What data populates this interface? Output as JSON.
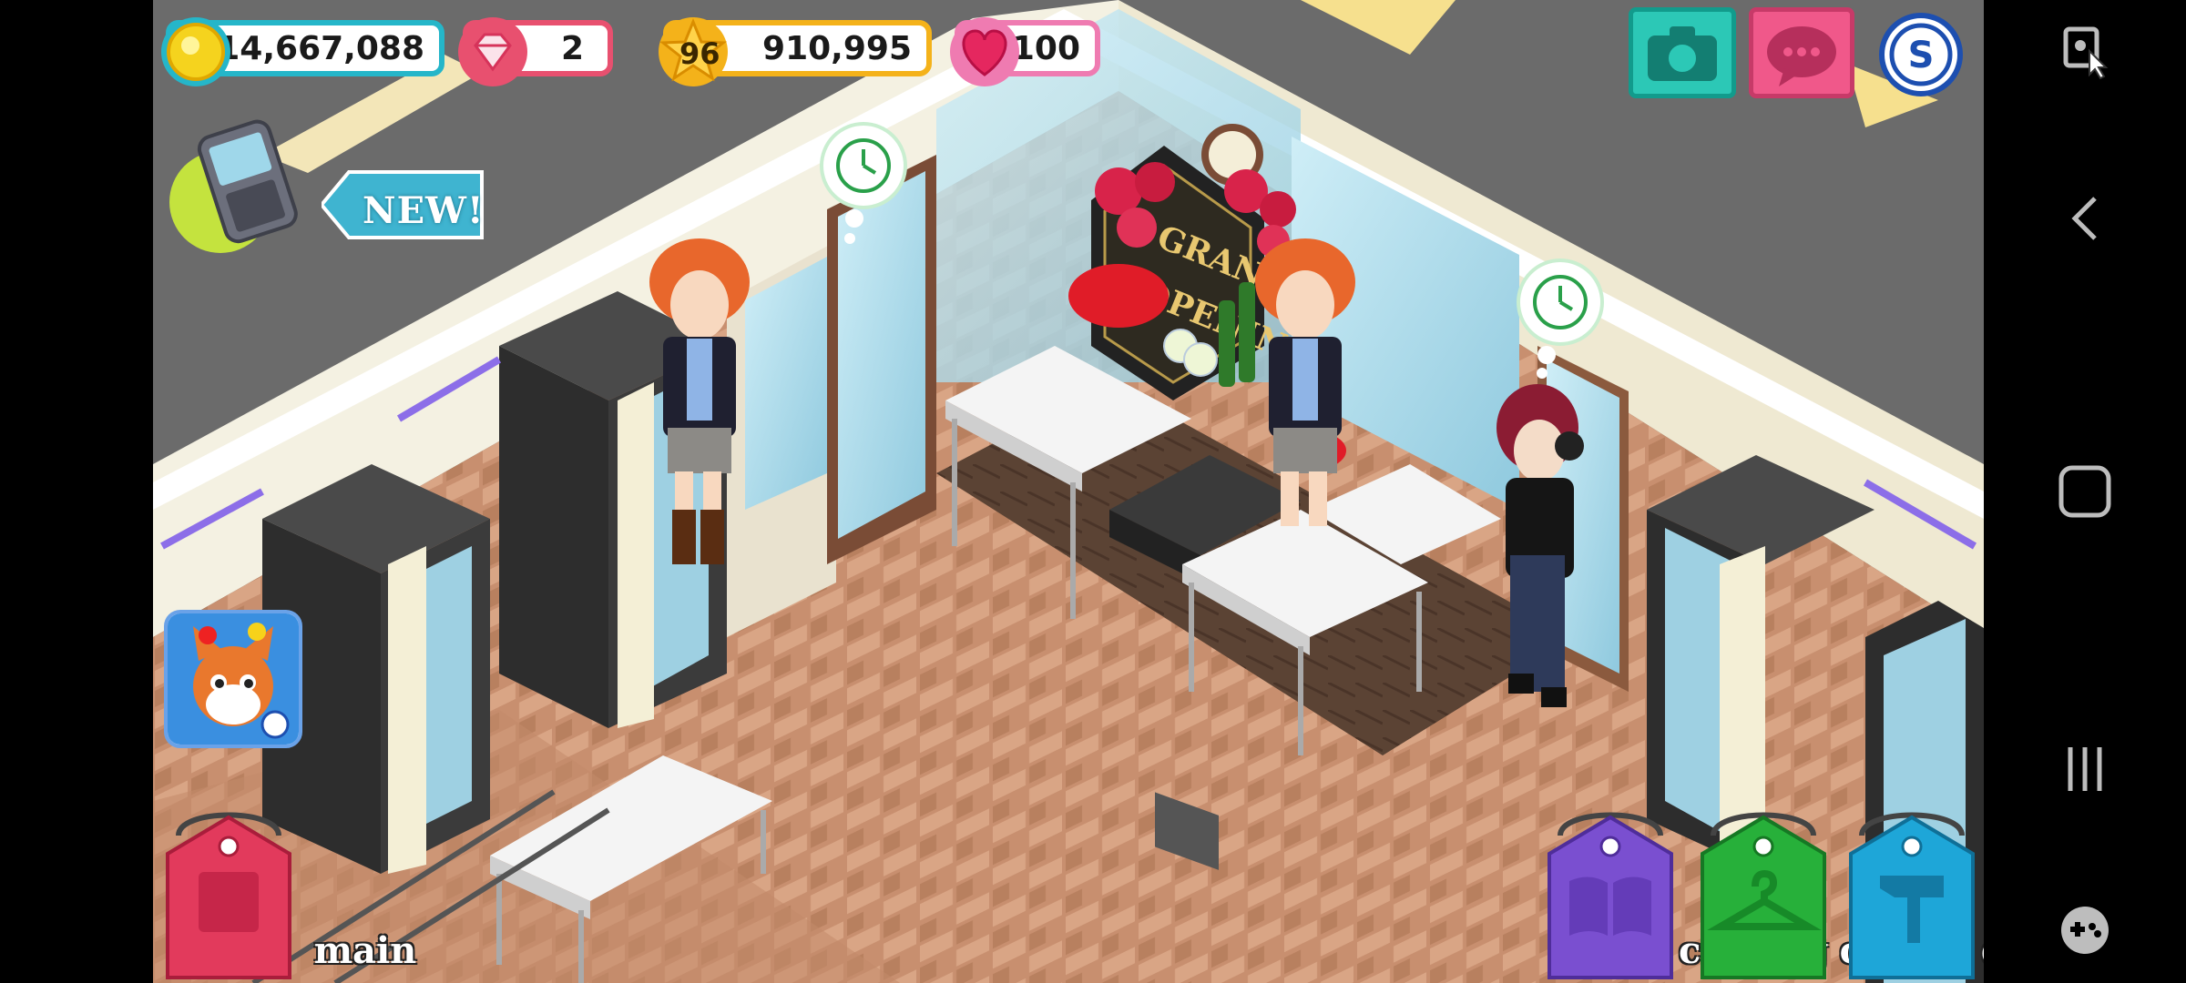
{
  "hud": {
    "coins": "14,667,088",
    "gems": "2",
    "level": "96",
    "experience": "910,995",
    "hearts": "100"
  },
  "badges": {
    "new_label": "NEW!"
  },
  "scene": {
    "sign_line1": "GRAND",
    "sign_line2": "OPENING"
  },
  "bottom_tabs": {
    "main": "main",
    "catalog": "catalog",
    "closet": "closet",
    "design": "design"
  },
  "colors": {
    "coin_border": "#25b6c9",
    "gem_border": "#e8506f",
    "xp_border": "#f4b21a",
    "heart_border": "#ef7bb1",
    "main_tab": "#e23a5c",
    "catalog_tab": "#7a4fd0",
    "closet_tab": "#27b03a",
    "design_tab": "#1ea6d8"
  },
  "icons": {
    "coin": "coin-icon",
    "gem": "gem-icon",
    "star": "star-icon",
    "heart": "heart-icon",
    "camera": "camera-icon",
    "chat": "chat-icon",
    "store": "store-icon",
    "phone": "phone-icon",
    "clock": "clock-icon"
  }
}
